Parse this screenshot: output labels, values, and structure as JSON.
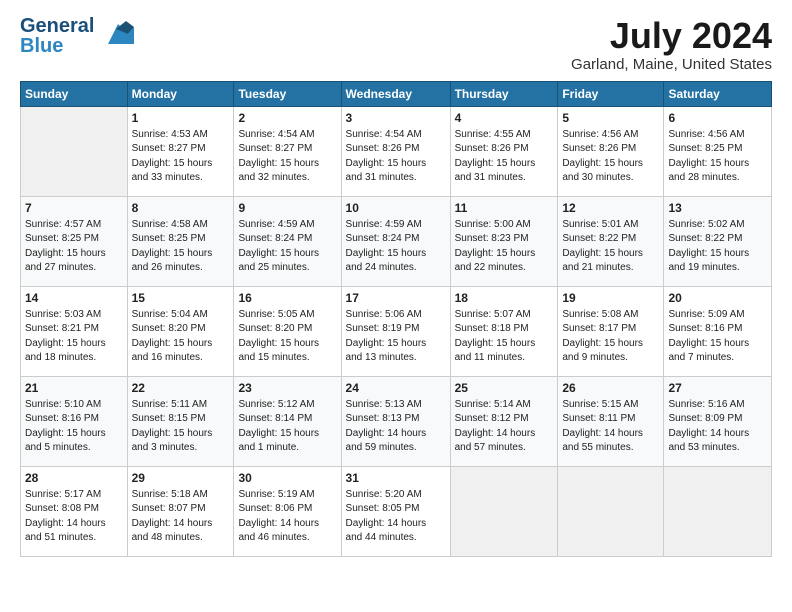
{
  "header": {
    "logo_general": "General",
    "logo_blue": "Blue",
    "title": "July 2024",
    "subtitle": "Garland, Maine, United States"
  },
  "weekdays": [
    "Sunday",
    "Monday",
    "Tuesday",
    "Wednesday",
    "Thursday",
    "Friday",
    "Saturday"
  ],
  "weeks": [
    [
      {
        "day": "",
        "content": ""
      },
      {
        "day": "1",
        "content": "Sunrise: 4:53 AM\nSunset: 8:27 PM\nDaylight: 15 hours\nand 33 minutes."
      },
      {
        "day": "2",
        "content": "Sunrise: 4:54 AM\nSunset: 8:27 PM\nDaylight: 15 hours\nand 32 minutes."
      },
      {
        "day": "3",
        "content": "Sunrise: 4:54 AM\nSunset: 8:26 PM\nDaylight: 15 hours\nand 31 minutes."
      },
      {
        "day": "4",
        "content": "Sunrise: 4:55 AM\nSunset: 8:26 PM\nDaylight: 15 hours\nand 31 minutes."
      },
      {
        "day": "5",
        "content": "Sunrise: 4:56 AM\nSunset: 8:26 PM\nDaylight: 15 hours\nand 30 minutes."
      },
      {
        "day": "6",
        "content": "Sunrise: 4:56 AM\nSunset: 8:25 PM\nDaylight: 15 hours\nand 28 minutes."
      }
    ],
    [
      {
        "day": "7",
        "content": "Sunrise: 4:57 AM\nSunset: 8:25 PM\nDaylight: 15 hours\nand 27 minutes."
      },
      {
        "day": "8",
        "content": "Sunrise: 4:58 AM\nSunset: 8:25 PM\nDaylight: 15 hours\nand 26 minutes."
      },
      {
        "day": "9",
        "content": "Sunrise: 4:59 AM\nSunset: 8:24 PM\nDaylight: 15 hours\nand 25 minutes."
      },
      {
        "day": "10",
        "content": "Sunrise: 4:59 AM\nSunset: 8:24 PM\nDaylight: 15 hours\nand 24 minutes."
      },
      {
        "day": "11",
        "content": "Sunrise: 5:00 AM\nSunset: 8:23 PM\nDaylight: 15 hours\nand 22 minutes."
      },
      {
        "day": "12",
        "content": "Sunrise: 5:01 AM\nSunset: 8:22 PM\nDaylight: 15 hours\nand 21 minutes."
      },
      {
        "day": "13",
        "content": "Sunrise: 5:02 AM\nSunset: 8:22 PM\nDaylight: 15 hours\nand 19 minutes."
      }
    ],
    [
      {
        "day": "14",
        "content": "Sunrise: 5:03 AM\nSunset: 8:21 PM\nDaylight: 15 hours\nand 18 minutes."
      },
      {
        "day": "15",
        "content": "Sunrise: 5:04 AM\nSunset: 8:20 PM\nDaylight: 15 hours\nand 16 minutes."
      },
      {
        "day": "16",
        "content": "Sunrise: 5:05 AM\nSunset: 8:20 PM\nDaylight: 15 hours\nand 15 minutes."
      },
      {
        "day": "17",
        "content": "Sunrise: 5:06 AM\nSunset: 8:19 PM\nDaylight: 15 hours\nand 13 minutes."
      },
      {
        "day": "18",
        "content": "Sunrise: 5:07 AM\nSunset: 8:18 PM\nDaylight: 15 hours\nand 11 minutes."
      },
      {
        "day": "19",
        "content": "Sunrise: 5:08 AM\nSunset: 8:17 PM\nDaylight: 15 hours\nand 9 minutes."
      },
      {
        "day": "20",
        "content": "Sunrise: 5:09 AM\nSunset: 8:16 PM\nDaylight: 15 hours\nand 7 minutes."
      }
    ],
    [
      {
        "day": "21",
        "content": "Sunrise: 5:10 AM\nSunset: 8:16 PM\nDaylight: 15 hours\nand 5 minutes."
      },
      {
        "day": "22",
        "content": "Sunrise: 5:11 AM\nSunset: 8:15 PM\nDaylight: 15 hours\nand 3 minutes."
      },
      {
        "day": "23",
        "content": "Sunrise: 5:12 AM\nSunset: 8:14 PM\nDaylight: 15 hours\nand 1 minute."
      },
      {
        "day": "24",
        "content": "Sunrise: 5:13 AM\nSunset: 8:13 PM\nDaylight: 14 hours\nand 59 minutes."
      },
      {
        "day": "25",
        "content": "Sunrise: 5:14 AM\nSunset: 8:12 PM\nDaylight: 14 hours\nand 57 minutes."
      },
      {
        "day": "26",
        "content": "Sunrise: 5:15 AM\nSunset: 8:11 PM\nDaylight: 14 hours\nand 55 minutes."
      },
      {
        "day": "27",
        "content": "Sunrise: 5:16 AM\nSunset: 8:09 PM\nDaylight: 14 hours\nand 53 minutes."
      }
    ],
    [
      {
        "day": "28",
        "content": "Sunrise: 5:17 AM\nSunset: 8:08 PM\nDaylight: 14 hours\nand 51 minutes."
      },
      {
        "day": "29",
        "content": "Sunrise: 5:18 AM\nSunset: 8:07 PM\nDaylight: 14 hours\nand 48 minutes."
      },
      {
        "day": "30",
        "content": "Sunrise: 5:19 AM\nSunset: 8:06 PM\nDaylight: 14 hours\nand 46 minutes."
      },
      {
        "day": "31",
        "content": "Sunrise: 5:20 AM\nSunset: 8:05 PM\nDaylight: 14 hours\nand 44 minutes."
      },
      {
        "day": "",
        "content": ""
      },
      {
        "day": "",
        "content": ""
      },
      {
        "day": "",
        "content": ""
      }
    ]
  ]
}
